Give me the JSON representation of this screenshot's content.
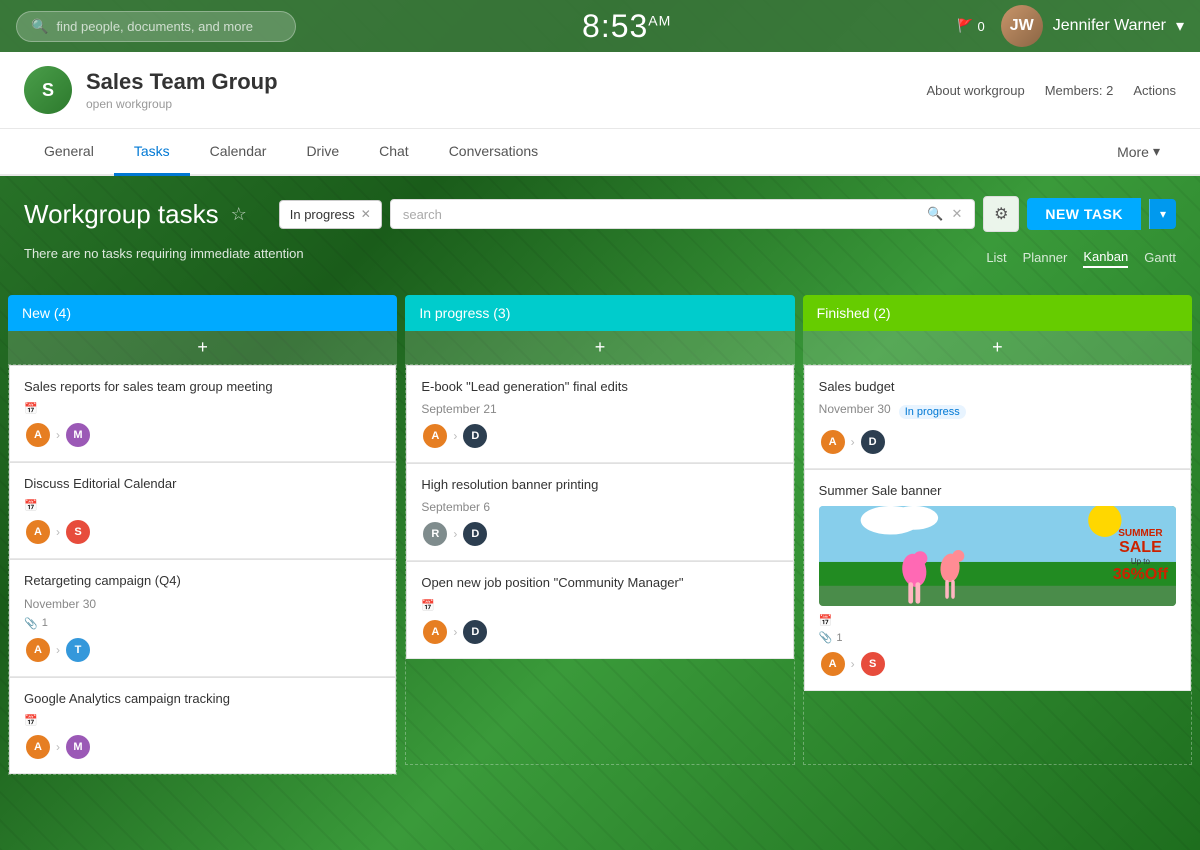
{
  "topbar": {
    "search_placeholder": "find people, documents, and more",
    "time": "8:53",
    "time_suffix": "AM",
    "flag_count": "0",
    "user_name": "Jennifer Warner",
    "user_initials": "JW"
  },
  "workgroup": {
    "title": "Sales Team Group",
    "subtitle": "open workgroup",
    "initials": "S",
    "about_label": "About workgroup",
    "members_label": "Members: 2",
    "actions_label": "Actions"
  },
  "nav": {
    "tabs": [
      {
        "label": "General",
        "active": false
      },
      {
        "label": "Tasks",
        "active": true
      },
      {
        "label": "Calendar",
        "active": false
      },
      {
        "label": "Drive",
        "active": false
      },
      {
        "label": "Chat",
        "active": false
      },
      {
        "label": "Conversations",
        "active": false
      }
    ],
    "more_label": "More"
  },
  "tasks_header": {
    "title": "Workgroup tasks",
    "filter_chip": "In progress",
    "search_placeholder": "search",
    "new_task_label": "NEW TASK",
    "attention_msg": "There are no tasks requiring immediate attention"
  },
  "view_switcher": {
    "options": [
      "List",
      "Planner",
      "Kanban",
      "Gantt"
    ],
    "active": "Kanban"
  },
  "columns": [
    {
      "label": "New",
      "count": 4,
      "color_class": "col-new",
      "tasks": [
        {
          "title": "Sales reports for sales team group meeting",
          "date": "",
          "avatar1": "#e67e22",
          "avatar1_initials": "A",
          "avatar2": "#9b59b6",
          "avatar2_initials": "M",
          "has_calendar": true,
          "has_attachment": false,
          "attachment_count": 0
        },
        {
          "title": "Discuss Editorial Calendar",
          "date": "",
          "avatar1": "#e67e22",
          "avatar1_initials": "A",
          "avatar2": "#e74c3c",
          "avatar2_initials": "S",
          "has_calendar": true,
          "has_attachment": false,
          "attachment_count": 0
        },
        {
          "title": "Retargeting campaign (Q4)",
          "date": "November 30",
          "avatar1": "#e67e22",
          "avatar1_initials": "A",
          "avatar2": "#3498db",
          "avatar2_initials": "T",
          "has_calendar": false,
          "has_attachment": true,
          "attachment_count": 1
        },
        {
          "title": "Google Analytics campaign tracking",
          "date": "",
          "avatar1": "#e67e22",
          "avatar1_initials": "A",
          "avatar2": "#9b59b6",
          "avatar2_initials": "M",
          "has_calendar": true,
          "has_attachment": false,
          "attachment_count": 0
        }
      ]
    },
    {
      "label": "In progress",
      "count": 3,
      "color_class": "col-inprogress",
      "tasks": [
        {
          "title": "E-book \"Lead generation\" final edits",
          "date": "September 21",
          "avatar1": "#e67e22",
          "avatar1_initials": "A",
          "avatar2": "#2c3e50",
          "avatar2_initials": "D",
          "has_calendar": false,
          "has_attachment": false,
          "attachment_count": 0
        },
        {
          "title": "High resolution banner printing",
          "date": "September 6",
          "avatar1": "#7f8c8d",
          "avatar1_initials": "R",
          "avatar2": "#2c3e50",
          "avatar2_initials": "D",
          "has_calendar": false,
          "has_attachment": false,
          "attachment_count": 0
        },
        {
          "title": "Open new job position \"Community Manager\"",
          "date": "",
          "avatar1": "#e67e22",
          "avatar1_initials": "A",
          "avatar2": "#2c3e50",
          "avatar2_initials": "D",
          "has_calendar": true,
          "has_attachment": false,
          "attachment_count": 0
        }
      ]
    },
    {
      "label": "Finished",
      "count": 2,
      "color_class": "col-finished",
      "tasks": [
        {
          "title": "Sales budget",
          "date": "November 30",
          "status_badge": "In progress",
          "avatar1": "#e67e22",
          "avatar1_initials": "A",
          "avatar2": "#2c3e50",
          "avatar2_initials": "D",
          "has_calendar": false,
          "has_attachment": false,
          "attachment_count": 0,
          "has_summer_sale": false
        },
        {
          "title": "Summer Sale banner",
          "date": "",
          "avatar1": "#e67e22",
          "avatar1_initials": "A",
          "avatar2": "#e74c3c",
          "avatar2_initials": "S",
          "has_calendar": true,
          "has_attachment": true,
          "attachment_count": 1,
          "has_summer_sale": true
        }
      ]
    }
  ]
}
